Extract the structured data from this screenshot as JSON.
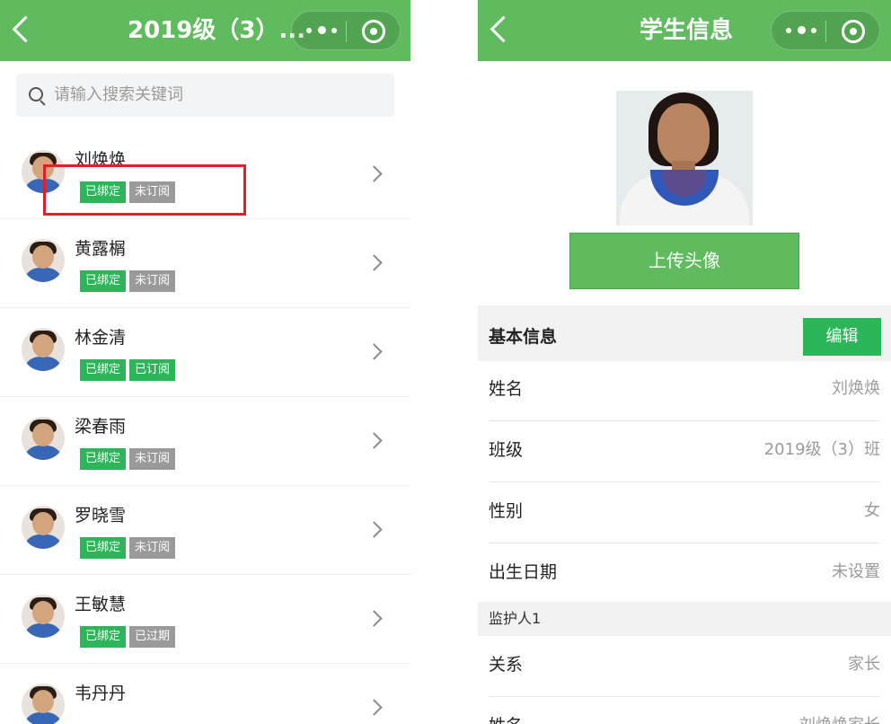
{
  "left": {
    "title": "2019级（3）...",
    "search_placeholder": "请输入搜索关键词",
    "students": [
      {
        "name": "刘焕焕",
        "tags": [
          {
            "text": "已绑定",
            "style": "green"
          },
          {
            "text": "未订阅",
            "style": "gray"
          }
        ]
      },
      {
        "name": "黄露榍",
        "tags": [
          {
            "text": "已绑定",
            "style": "green"
          },
          {
            "text": "未订阅",
            "style": "gray"
          }
        ]
      },
      {
        "name": "林金清",
        "tags": [
          {
            "text": "已绑定",
            "style": "green"
          },
          {
            "text": "已订阅",
            "style": "green"
          }
        ]
      },
      {
        "name": "梁春雨",
        "tags": [
          {
            "text": "已绑定",
            "style": "green"
          },
          {
            "text": "未订阅",
            "style": "gray"
          }
        ]
      },
      {
        "name": "罗晓雪",
        "tags": [
          {
            "text": "已绑定",
            "style": "green"
          },
          {
            "text": "未订阅",
            "style": "gray"
          }
        ]
      },
      {
        "name": "王敏慧",
        "tags": [
          {
            "text": "已绑定",
            "style": "green"
          },
          {
            "text": "已过期",
            "style": "gray"
          }
        ]
      },
      {
        "name": "韦丹丹",
        "tags": []
      }
    ]
  },
  "right": {
    "title": "学生信息",
    "upload_label": "上传头像",
    "section_title": "基本信息",
    "edit_label": "编辑",
    "fields": [
      {
        "label": "姓名",
        "value": "刘焕焕"
      },
      {
        "label": "班级",
        "value": "2019级（3）班"
      },
      {
        "label": "性别",
        "value": "女"
      },
      {
        "label": "出生日期",
        "value": "未设置"
      }
    ],
    "guardian_title": "监护人1",
    "guardian_fields": [
      {
        "label": "关系",
        "value": "家长"
      },
      {
        "label": "姓名",
        "value": "刘焕焕家长"
      }
    ]
  },
  "colors": {
    "header": "#5fbb5e",
    "tag_green": "#2db55a",
    "tag_gray": "#9a9a9a",
    "highlight": "#e41e26"
  }
}
